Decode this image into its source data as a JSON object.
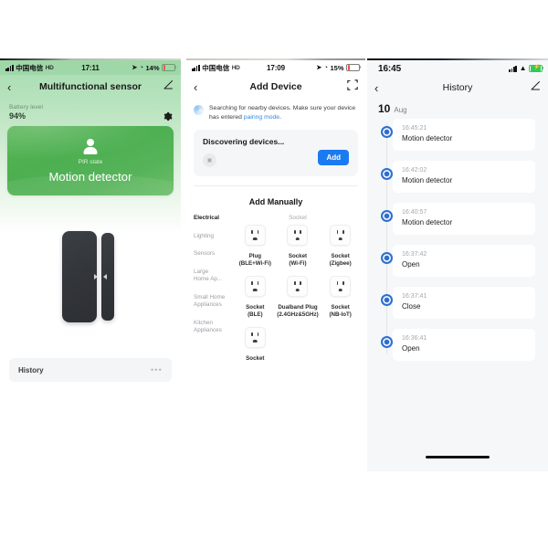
{
  "left_panel": {
    "status_bar": {
      "carrier": "中国电信",
      "hd_icon": "hd-icon",
      "time": "17:11",
      "location_icon": "location-arrow-icon",
      "alarm_icon": "alarm-icon",
      "battery_percent": "14%"
    },
    "nav": {
      "back_icon": "chevron-left-icon",
      "title": "Multifunctional sensor",
      "edit_icon": "pencil-icon"
    },
    "battery": {
      "label": "Battery level",
      "value": "94%",
      "settings_icon": "gear-icon"
    },
    "state_card": {
      "icon": "person-icon",
      "caption": "PIR state",
      "value": "Motion detector",
      "color": "#4caf50"
    },
    "device_image": "door-window-sensor-image",
    "history_row": {
      "label": "History",
      "more_icon": "ellipsis-icon"
    }
  },
  "mid_panel": {
    "status_bar": {
      "carrier": "中国电信",
      "hd_icon": "hd-icon",
      "time": "17:09",
      "battery_percent": "15%"
    },
    "nav": {
      "back_icon": "chevron-left-icon",
      "title": "Add Device",
      "scan_icon": "scan-qr-icon"
    },
    "searching": {
      "text_before": "Searching for nearby devices. Make sure your device has entered ",
      "link": "pairing mode",
      "text_after": ".",
      "spinner_icon": "loading-spinner-icon"
    },
    "discovering": {
      "title": "Discovering devices...",
      "add_label": "Add",
      "thumb_icon": "device-thumb-icon",
      "accent": "#1c7af0"
    },
    "add_manually": "Add Manually",
    "categories": [
      {
        "label": "Electrical",
        "active": true
      },
      {
        "label": "Lighting",
        "active": false
      },
      {
        "label": "Sensors",
        "active": false
      },
      {
        "label": "Large\nHome Ap...",
        "active": false
      },
      {
        "label": "Small Home\nAppliances",
        "active": false
      },
      {
        "label": "Kitchen\nAppliances",
        "active": false
      }
    ],
    "product_group": "Socket",
    "products": [
      {
        "name": "Plug",
        "sub": "(BLE+Wi-Fi)",
        "icon": "socket-icon"
      },
      {
        "name": "Socket",
        "sub": "(Wi-Fi)",
        "icon": "socket-icon"
      },
      {
        "name": "Socket",
        "sub": "(Zigbee)",
        "icon": "socket-icon"
      },
      {
        "name": "Socket",
        "sub": "(BLE)",
        "icon": "socket-icon"
      },
      {
        "name": "Dualband Plug",
        "sub": "(2.4GHz&5GHz)",
        "icon": "socket-icon"
      },
      {
        "name": "Socket",
        "sub": "(NB-IoT)",
        "icon": "socket-icon"
      },
      {
        "name": "Socket",
        "sub": "",
        "icon": "socket-icon"
      }
    ]
  },
  "right_panel": {
    "status_bar": {
      "time": "16:45",
      "signal_icon": "cellular-bars-icon",
      "wifi_icon": "wifi-icon",
      "battery_icon": "battery-charging-icon"
    },
    "nav": {
      "back_icon": "chevron-left-icon",
      "title": "History",
      "edit_icon": "pencil-icon"
    },
    "date": {
      "day": "10",
      "month": "Aug"
    },
    "events": [
      {
        "time": "16:45:21",
        "event": "Motion detector"
      },
      {
        "time": "16:42:02",
        "event": "Motion detector"
      },
      {
        "time": "16:40:57",
        "event": "Motion detector"
      },
      {
        "time": "16:37:42",
        "event": "Open"
      },
      {
        "time": "16:37:41",
        "event": "Close"
      },
      {
        "time": "16:36:41",
        "event": "Open"
      }
    ],
    "dot_color": "#2f6fd0",
    "home_indicator": "home-indicator"
  }
}
